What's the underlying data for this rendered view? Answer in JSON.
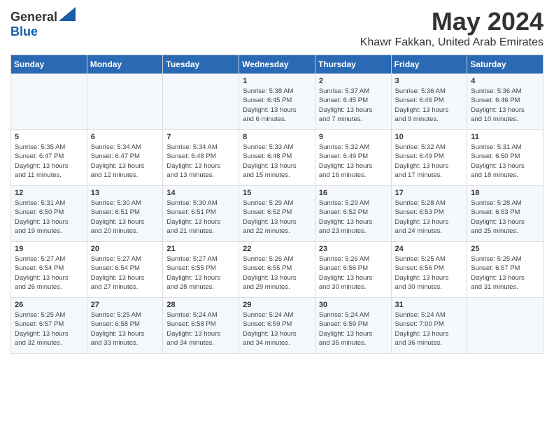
{
  "header": {
    "logo_general": "General",
    "logo_blue": "Blue",
    "title": "May 2024",
    "subtitle": "Khawr Fakkan, United Arab Emirates"
  },
  "weekdays": [
    "Sunday",
    "Monday",
    "Tuesday",
    "Wednesday",
    "Thursday",
    "Friday",
    "Saturday"
  ],
  "weeks": [
    [
      {
        "day": "",
        "info": ""
      },
      {
        "day": "",
        "info": ""
      },
      {
        "day": "",
        "info": ""
      },
      {
        "day": "1",
        "info": "Sunrise: 5:38 AM\nSunset: 6:45 PM\nDaylight: 13 hours\nand 6 minutes."
      },
      {
        "day": "2",
        "info": "Sunrise: 5:37 AM\nSunset: 6:45 PM\nDaylight: 13 hours\nand 7 minutes."
      },
      {
        "day": "3",
        "info": "Sunrise: 5:36 AM\nSunset: 6:46 PM\nDaylight: 13 hours\nand 9 minutes."
      },
      {
        "day": "4",
        "info": "Sunrise: 5:36 AM\nSunset: 6:46 PM\nDaylight: 13 hours\nand 10 minutes."
      }
    ],
    [
      {
        "day": "5",
        "info": "Sunrise: 5:35 AM\nSunset: 6:47 PM\nDaylight: 13 hours\nand 11 minutes."
      },
      {
        "day": "6",
        "info": "Sunrise: 5:34 AM\nSunset: 6:47 PM\nDaylight: 13 hours\nand 12 minutes."
      },
      {
        "day": "7",
        "info": "Sunrise: 5:34 AM\nSunset: 6:48 PM\nDaylight: 13 hours\nand 13 minutes."
      },
      {
        "day": "8",
        "info": "Sunrise: 5:33 AM\nSunset: 6:48 PM\nDaylight: 13 hours\nand 15 minutes."
      },
      {
        "day": "9",
        "info": "Sunrise: 5:32 AM\nSunset: 6:49 PM\nDaylight: 13 hours\nand 16 minutes."
      },
      {
        "day": "10",
        "info": "Sunrise: 5:32 AM\nSunset: 6:49 PM\nDaylight: 13 hours\nand 17 minutes."
      },
      {
        "day": "11",
        "info": "Sunrise: 5:31 AM\nSunset: 6:50 PM\nDaylight: 13 hours\nand 18 minutes."
      }
    ],
    [
      {
        "day": "12",
        "info": "Sunrise: 5:31 AM\nSunset: 6:50 PM\nDaylight: 13 hours\nand 19 minutes."
      },
      {
        "day": "13",
        "info": "Sunrise: 5:30 AM\nSunset: 6:51 PM\nDaylight: 13 hours\nand 20 minutes."
      },
      {
        "day": "14",
        "info": "Sunrise: 5:30 AM\nSunset: 6:51 PM\nDaylight: 13 hours\nand 21 minutes."
      },
      {
        "day": "15",
        "info": "Sunrise: 5:29 AM\nSunset: 6:52 PM\nDaylight: 13 hours\nand 22 minutes."
      },
      {
        "day": "16",
        "info": "Sunrise: 5:29 AM\nSunset: 6:52 PM\nDaylight: 13 hours\nand 23 minutes."
      },
      {
        "day": "17",
        "info": "Sunrise: 5:28 AM\nSunset: 6:53 PM\nDaylight: 13 hours\nand 24 minutes."
      },
      {
        "day": "18",
        "info": "Sunrise: 5:28 AM\nSunset: 6:53 PM\nDaylight: 13 hours\nand 25 minutes."
      }
    ],
    [
      {
        "day": "19",
        "info": "Sunrise: 5:27 AM\nSunset: 6:54 PM\nDaylight: 13 hours\nand 26 minutes."
      },
      {
        "day": "20",
        "info": "Sunrise: 5:27 AM\nSunset: 6:54 PM\nDaylight: 13 hours\nand 27 minutes."
      },
      {
        "day": "21",
        "info": "Sunrise: 5:27 AM\nSunset: 6:55 PM\nDaylight: 13 hours\nand 28 minutes."
      },
      {
        "day": "22",
        "info": "Sunrise: 5:26 AM\nSunset: 6:55 PM\nDaylight: 13 hours\nand 29 minutes."
      },
      {
        "day": "23",
        "info": "Sunrise: 5:26 AM\nSunset: 6:56 PM\nDaylight: 13 hours\nand 30 minutes."
      },
      {
        "day": "24",
        "info": "Sunrise: 5:25 AM\nSunset: 6:56 PM\nDaylight: 13 hours\nand 30 minutes."
      },
      {
        "day": "25",
        "info": "Sunrise: 5:25 AM\nSunset: 6:57 PM\nDaylight: 13 hours\nand 31 minutes."
      }
    ],
    [
      {
        "day": "26",
        "info": "Sunrise: 5:25 AM\nSunset: 6:57 PM\nDaylight: 13 hours\nand 32 minutes."
      },
      {
        "day": "27",
        "info": "Sunrise: 5:25 AM\nSunset: 6:58 PM\nDaylight: 13 hours\nand 33 minutes."
      },
      {
        "day": "28",
        "info": "Sunrise: 5:24 AM\nSunset: 6:58 PM\nDaylight: 13 hours\nand 34 minutes."
      },
      {
        "day": "29",
        "info": "Sunrise: 5:24 AM\nSunset: 6:59 PM\nDaylight: 13 hours\nand 34 minutes."
      },
      {
        "day": "30",
        "info": "Sunrise: 5:24 AM\nSunset: 6:59 PM\nDaylight: 13 hours\nand 35 minutes."
      },
      {
        "day": "31",
        "info": "Sunrise: 5:24 AM\nSunset: 7:00 PM\nDaylight: 13 hours\nand 36 minutes."
      },
      {
        "day": "",
        "info": ""
      }
    ]
  ]
}
